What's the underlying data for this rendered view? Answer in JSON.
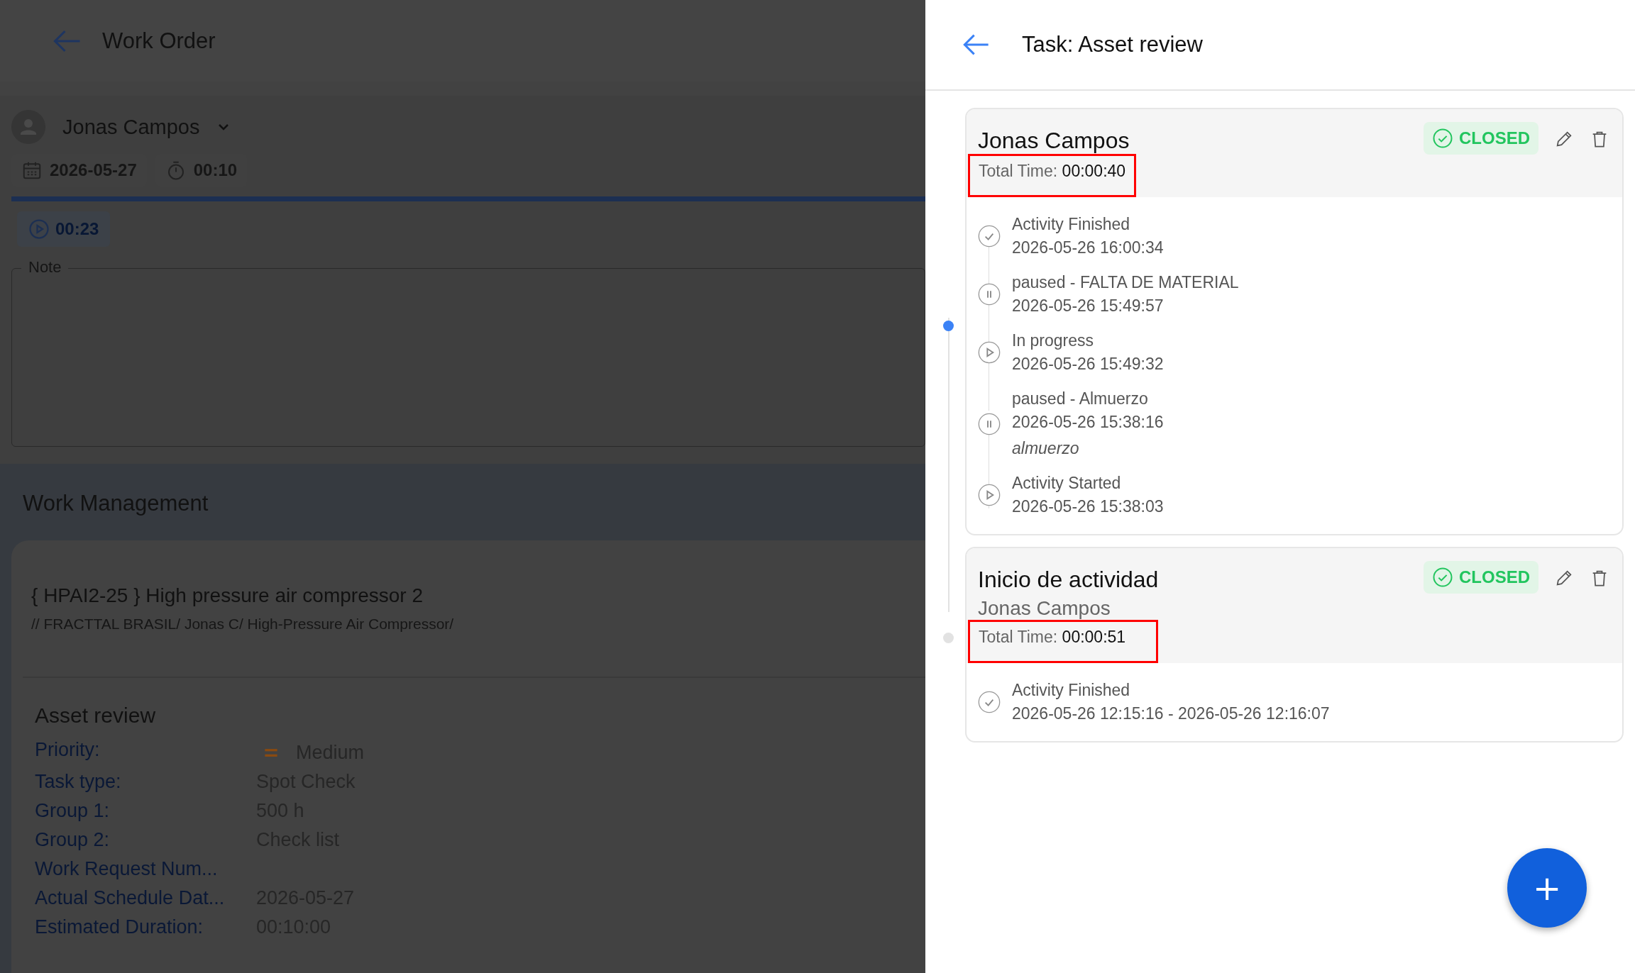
{
  "work_order": {
    "title": "Work Order",
    "assignee": {
      "name": "Jonas Campos",
      "expanded": false
    },
    "date": "2026-05-27",
    "duration": "00:10",
    "progress": {
      "level": 1
    },
    "elapsed": "00:23",
    "note": {
      "label": "Note"
    },
    "section_title": "Work Management",
    "asset": {
      "title": "{ HPAI2-25 } High pressure air compressor 2",
      "path": "// FRACTTAL BRASIL/ Jonas C/ High-Pressure Air Compressor/"
    },
    "task": {
      "title": "Asset review",
      "fields": [
        {
          "label": "Priority:",
          "value": "Medium",
          "kind": "priority"
        },
        {
          "label": "Task type:",
          "value": "Spot Check",
          "kind": "text"
        },
        {
          "label": "Group 1:",
          "value": "500 h",
          "kind": "text"
        },
        {
          "label": "Group 2:",
          "value": "Check list",
          "kind": "text"
        },
        {
          "label": "Work Request Num...",
          "kind": "text"
        },
        {
          "label": "Actual Schedule Dat...",
          "value": "2026-05-27",
          "kind": "text"
        },
        {
          "label": "Estimated Duration:",
          "value": "00:10:00",
          "kind": "text"
        }
      ]
    }
  },
  "task_panel": {
    "title": "Task: Asset review",
    "cards": [
      {
        "title": "Jonas Campos",
        "active": true,
        "status": "CLOSED",
        "total_label": "Total Time:",
        "total_value": "00:00:40",
        "highlighted": true,
        "events": [
          {
            "kind": "check",
            "title": "Activity Finished",
            "time": "2026-05-26 16:00:34"
          },
          {
            "kind": "pause",
            "title": "paused - FALTA DE MATERIAL",
            "time": "2026-05-26 15:49:57"
          },
          {
            "kind": "play",
            "title": "In progress",
            "time": "2026-05-26 15:49:32"
          },
          {
            "kind": "pause",
            "title": "paused - Almuerzo",
            "time": "2026-05-26 15:38:16",
            "note": "almuerzo"
          },
          {
            "kind": "play",
            "title": "Activity Started",
            "time": "2026-05-26 15:38:03"
          }
        ]
      },
      {
        "title": "Inicio de actividad",
        "subtitle": "Jonas Campos",
        "active": false,
        "status": "CLOSED",
        "total_label": "Total Time:",
        "total_value": "00:00:51",
        "highlighted": true,
        "events": [
          {
            "kind": "check",
            "title": "Activity Finished",
            "time": "2026-05-26 12:15:16 - 2026-05-26 12:16:07"
          }
        ]
      }
    ],
    "add_button": "+"
  }
}
